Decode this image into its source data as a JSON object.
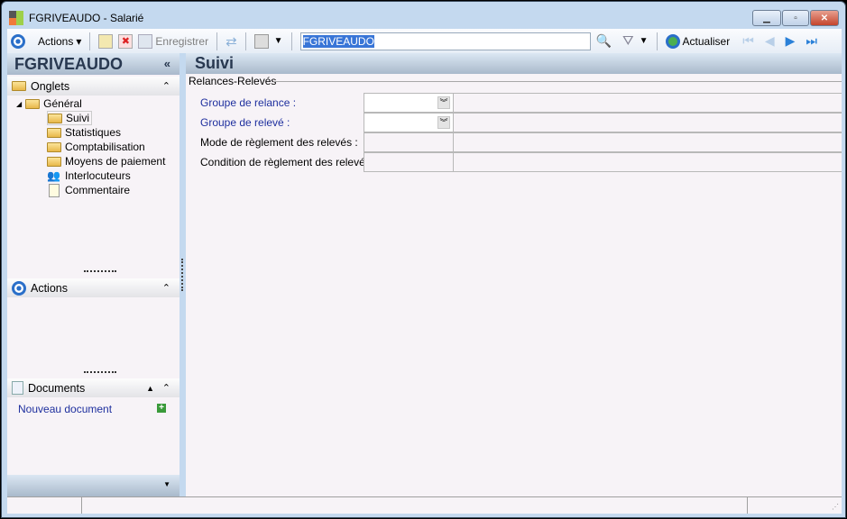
{
  "window": {
    "title": "FGRIVEAUDO -  Salarié",
    "controls": [
      "minimize",
      "maximize",
      "close"
    ]
  },
  "toolbar": {
    "actions_label": "Actions",
    "save_label": "Enregistrer",
    "search_value": "FGRIVEAUDO",
    "refresh_label": "Actualiser"
  },
  "left": {
    "record_title": "FGRIVEAUDO",
    "tabs_section": "Onglets",
    "tree_root": "Général",
    "tree_items": [
      {
        "label": "Suivi",
        "icon": "folder-open-icon"
      },
      {
        "label": "Statistiques",
        "icon": "folder-icon"
      },
      {
        "label": "Comptabilisation",
        "icon": "folder-icon"
      },
      {
        "label": "Moyens de paiement",
        "icon": "folder-icon"
      },
      {
        "label": "Interlocuteurs",
        "icon": "people-icon"
      },
      {
        "label": "Commentaire",
        "icon": "document-icon"
      }
    ],
    "actions_section": "Actions",
    "documents_section": "Documents",
    "new_document": "Nouveau document"
  },
  "main": {
    "title": "Suivi",
    "group": "Relances-Relevés",
    "fields": [
      {
        "label": "Groupe de relance :",
        "value": ""
      },
      {
        "label": "Groupe de relevé :",
        "value": ""
      },
      {
        "label": "Mode de règlement des relevés :",
        "value": ""
      },
      {
        "label": "Condition de règlement des relevés :",
        "value": ""
      }
    ]
  }
}
